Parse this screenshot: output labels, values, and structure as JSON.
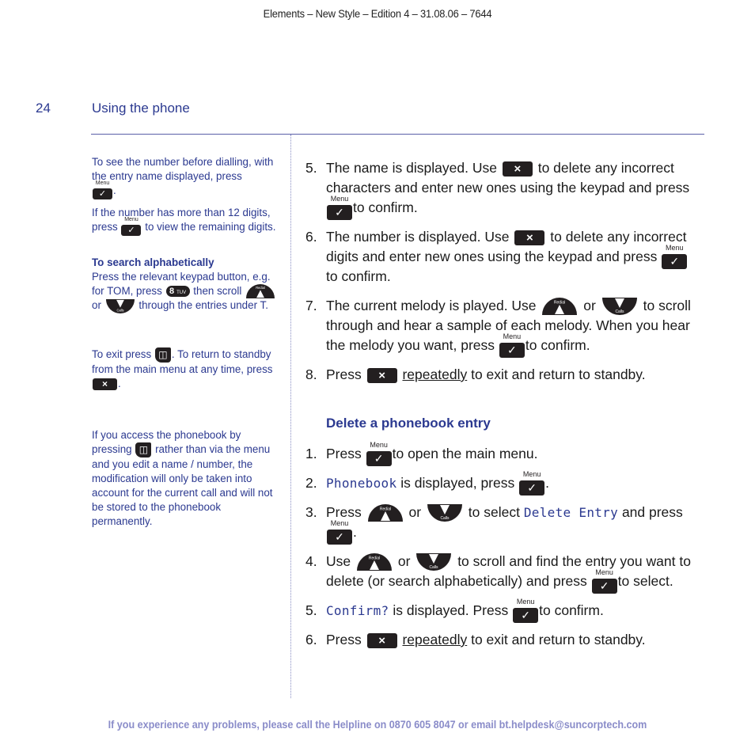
{
  "header": {
    "edition": "Elements – New Style – Edition 4 – 31.08.06 – 7644",
    "page_number": "24",
    "section_title": "Using the phone"
  },
  "icons": {
    "cancel_key": "×",
    "menu_key": "✓",
    "menu_label": "Menu",
    "redial_label": "Redial",
    "calls_label": "Calls",
    "key_8": "8",
    "key_8_letters": "TUV",
    "phonebook_key": "📖"
  },
  "sidebar": {
    "note1_text": "To see the number before dialling, with the entry name displayed, press",
    "note1_end": ".",
    "note2_a": "If the number has more than 12 digits, press",
    "note2_b": "to view the remaining digits.",
    "search_heading": "To search alphabetically",
    "search_a": "Press the relevant keypad button, e.g. for TOM, press",
    "search_b": "then scroll",
    "search_c": "or",
    "search_d": "through the entries under T.",
    "exit_a": "To exit press",
    "exit_b": ". To return to standby from the main menu at any time, press",
    "exit_c": ".",
    "access_a": "If you access the phonebook by pressing",
    "access_b": "rather than via the menu and you edit a name / number, the modification will only be taken into account for the current call and will not be stored to the phonebook permanently."
  },
  "edit_steps": [
    {
      "num": "5.",
      "a": "The name is displayed. Use",
      "b": "to delete any incorrect characters and enter new ones using the keypad and press",
      "c": "to confirm."
    },
    {
      "num": "6.",
      "a": "The number is displayed. Use",
      "b": "to delete any incorrect digits and enter new ones using the keypad and press",
      "c": "to confirm."
    },
    {
      "num": "7.",
      "a": "The current melody is played. Use",
      "or": "or",
      "b": "to scroll through and hear a sample of each melody. When you hear the melody you want, press",
      "c": "to confirm."
    },
    {
      "num": "8.",
      "a": "Press",
      "u": "repeatedly",
      "b": "to exit and return to standby."
    }
  ],
  "delete_section": {
    "heading": "Delete a phonebook entry",
    "steps": [
      {
        "num": "1.",
        "a": "Press",
        "b": "to open the main menu."
      },
      {
        "num": "2.",
        "lcd": "Phonebook",
        "a": "is displayed, press",
        "b": "."
      },
      {
        "num": "3.",
        "a": "Press",
        "or": "or",
        "b": "to select",
        "lcd": "Delete Entry",
        "c": "and press",
        "d": "."
      },
      {
        "num": "4.",
        "a": "Use",
        "or": "or",
        "b": "to scroll and find the entry you want to delete (or search alphabetically) and press",
        "c": "to select."
      },
      {
        "num": "5.",
        "lcd": "Confirm?",
        "a": "is displayed. Press",
        "b": "to confirm."
      },
      {
        "num": "6.",
        "a": "Press",
        "u": "repeatedly",
        "b": "to exit and return to standby."
      }
    ]
  },
  "footer": {
    "helpline": "If you experience any problems, please call the Helpline on 0870 605 8047 or email bt.helpdesk@suncorptech.com"
  }
}
